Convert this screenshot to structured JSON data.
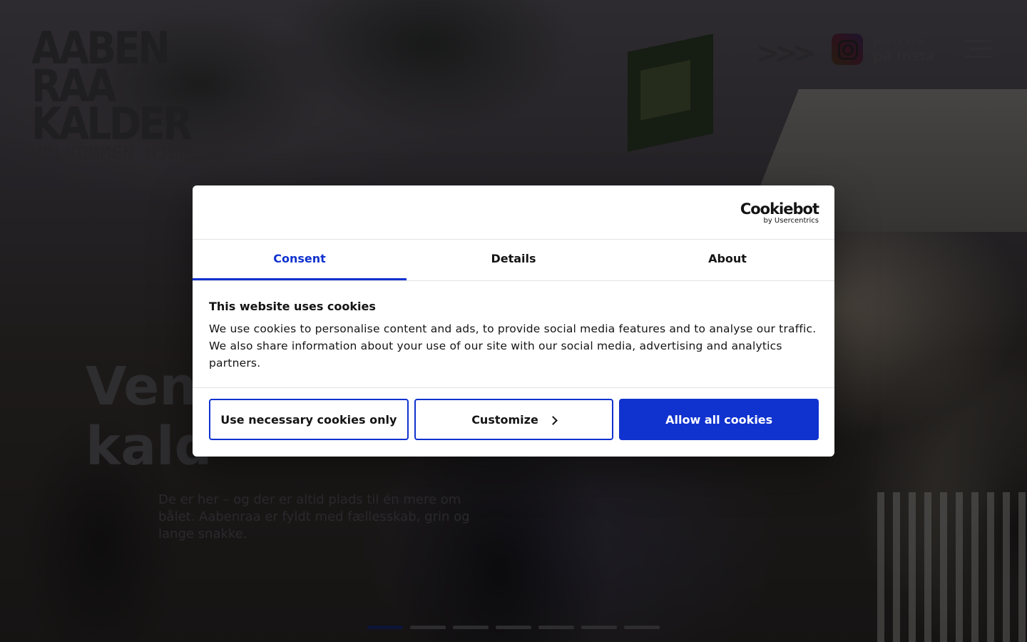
{
  "site": {
    "logo_lines": [
      "AABEN",
      "RAA",
      "KALDER"
    ],
    "logo_tagline": "VELKOMMEN HJEM",
    "arrows": ">>>",
    "insta_line1": "Join os",
    "insta_line2": "på Insta",
    "instagram_icon": "instagram-icon",
    "menu_icon": "hamburger-menu-icon"
  },
  "hero": {
    "title_line1": "Ven",
    "title_line2": "kald",
    "text": "De er her – og der er altid plads til én mere om bålet. Aabenraa er fyldt med fællesskab, grin og lange snakke.",
    "slides": 7,
    "active_slide": 1
  },
  "cookie_dialog": {
    "brand": "Cookiebot",
    "brand_sub": "by Usercentrics",
    "tabs": [
      "Consent",
      "Details",
      "About"
    ],
    "active_tab": "Consent",
    "heading": "This website uses cookies",
    "body": "We use cookies to personalise content and ads, to provide social media features and to analyse our traffic. We also share information about your use of our site with our social media, advertising and analytics partners.",
    "btn_necessary": "Use necessary cookies only",
    "btn_customize": "Customize",
    "btn_allow": "Allow all cookies"
  },
  "colors": {
    "accent": "#1032cf",
    "overlay": "rgba(0,0,0,0.5)"
  }
}
